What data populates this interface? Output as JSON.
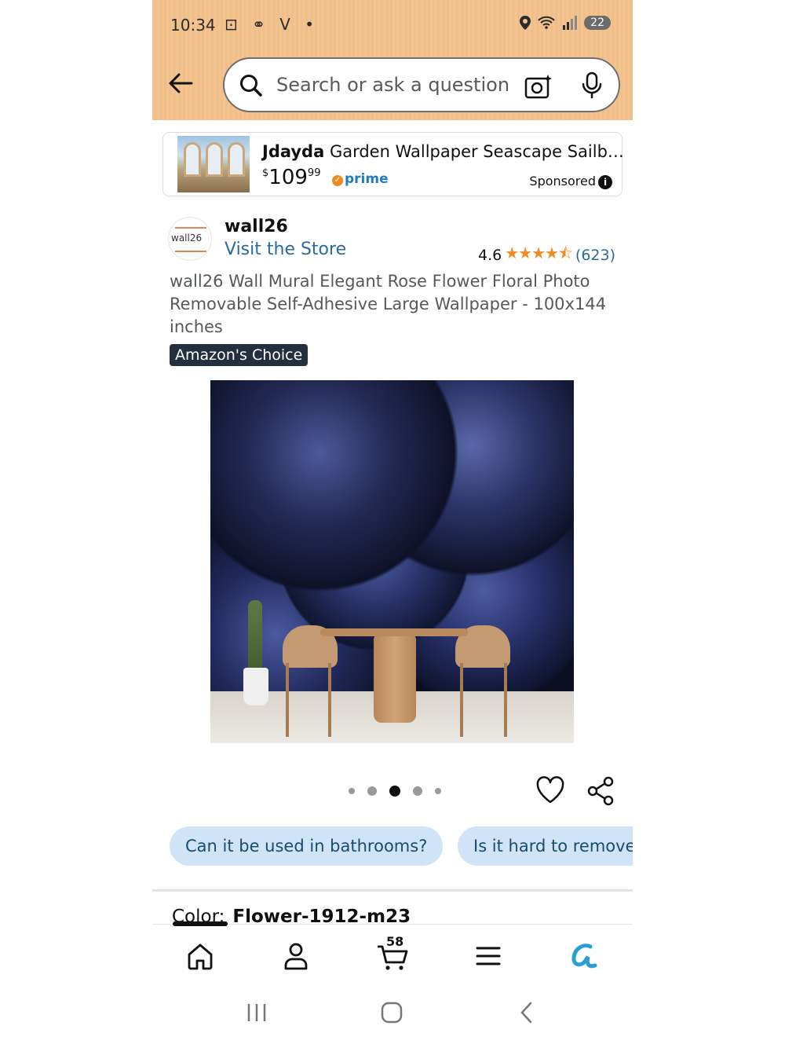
{
  "status_bar": {
    "time": "10:34",
    "left_icons": "⊡ ⚭ V •",
    "battery": "22"
  },
  "search": {
    "placeholder": "Search or ask a question"
  },
  "sponsored_ad": {
    "brand": "Jdayda",
    "title_rest": " Garden Wallpaper Seascape Sailb…",
    "price_currency": "$",
    "price_whole": "109",
    "price_fraction": "99",
    "prime_label": "prime",
    "sponsored_label": "Sponsored"
  },
  "store": {
    "logo_text": "wall26",
    "name": "wall26",
    "visit_label": "Visit the Store",
    "rating": "4.6",
    "stars": "★★★★⯪",
    "review_count": "(623)"
  },
  "product": {
    "title": "wall26 Wall Mural Elegant Rose Flower Floral Photo Removable Self-Adhesive Large Wallpaper - 100x144 inches",
    "badge": "Amazon's Choice",
    "image_count": 5,
    "active_image_index": 2
  },
  "questions": [
    "Can it be used in bathrooms?",
    "Is it hard to remove"
  ],
  "color": {
    "label": "Color:",
    "value": "Flower-1912-m23"
  },
  "bottom_nav": {
    "cart_count": "58",
    "items": [
      "home-icon",
      "account-icon",
      "cart-icon",
      "menu-icon",
      "rufus-icon"
    ]
  },
  "colors": {
    "header_bg": "#f3c48f",
    "link": "#2a6a9e",
    "star": "#f08a24",
    "chip_bg": "#cfe4f7",
    "badge_bg": "#232f3e"
  }
}
